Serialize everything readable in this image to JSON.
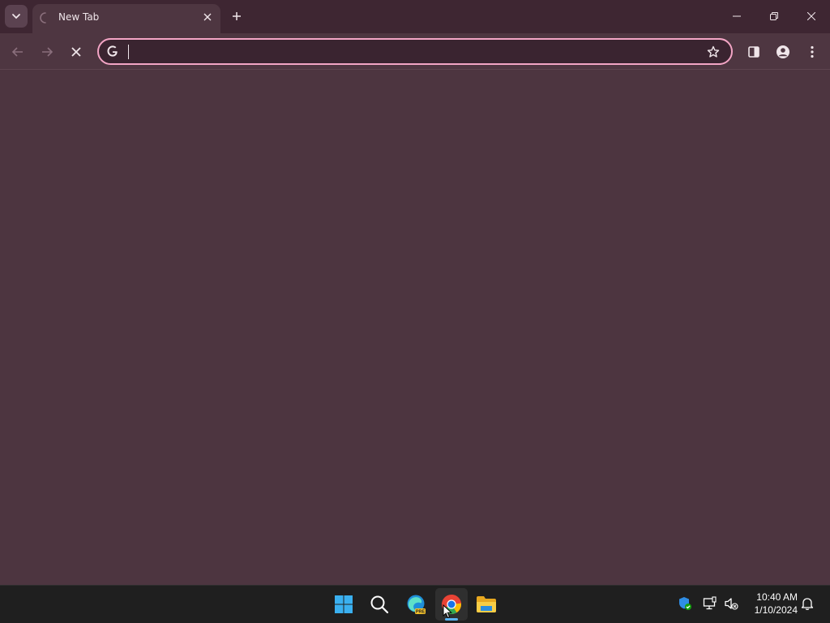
{
  "browser": {
    "tab": {
      "title": "New Tab",
      "loading": true
    },
    "omnibox": {
      "value": "",
      "placeholder": ""
    },
    "accent_color": "#f3a5c5",
    "content_background": "#4d3540"
  },
  "taskbar": {
    "apps": [
      "start-icon",
      "search-icon",
      "edge-beta-icon",
      "chrome-icon",
      "file-explorer-icon"
    ],
    "active_app": "chrome-icon",
    "edge_badge": "PRE",
    "clock": {
      "time": "10:40 AM",
      "date": "1/10/2024"
    }
  }
}
